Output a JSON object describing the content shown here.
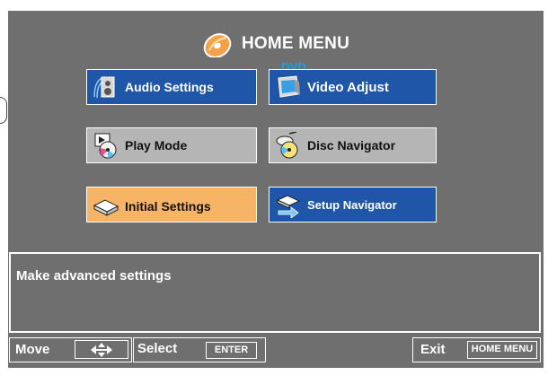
{
  "header": {
    "title": "HOME MENU",
    "subtitle": "DVD",
    "icon": "disc-icon"
  },
  "menu": {
    "items": [
      {
        "id": "audio",
        "label": "Audio Settings",
        "icon": "speaker-icon",
        "state": "normal"
      },
      {
        "id": "video",
        "label": "Video Adjust",
        "icon": "monitor-icon",
        "state": "normal"
      },
      {
        "id": "play",
        "label": "Play Mode",
        "icon": "play-mode-icon",
        "state": "disabled"
      },
      {
        "id": "disc",
        "label": "Disc Navigator",
        "icon": "disc-navigator-icon",
        "state": "disabled"
      },
      {
        "id": "initial",
        "label": "Initial Settings",
        "icon": "initial-settings-icon",
        "state": "selected"
      },
      {
        "id": "setup",
        "label": "Setup Navigator",
        "icon": "setup-navigator-icon",
        "state": "normal"
      }
    ]
  },
  "help": {
    "text": "Make advanced settings"
  },
  "footer": {
    "move_label": "Move",
    "select_label": "Select",
    "select_key": "ENTER",
    "exit_label": "Exit",
    "exit_key": "HOME MENU"
  },
  "colors": {
    "background": "#6f6f6f",
    "button_blue": "#1f56a8",
    "button_gray": "#b5b5b5",
    "button_selected": "#f7b366",
    "subtitle": "#17a3e0"
  }
}
